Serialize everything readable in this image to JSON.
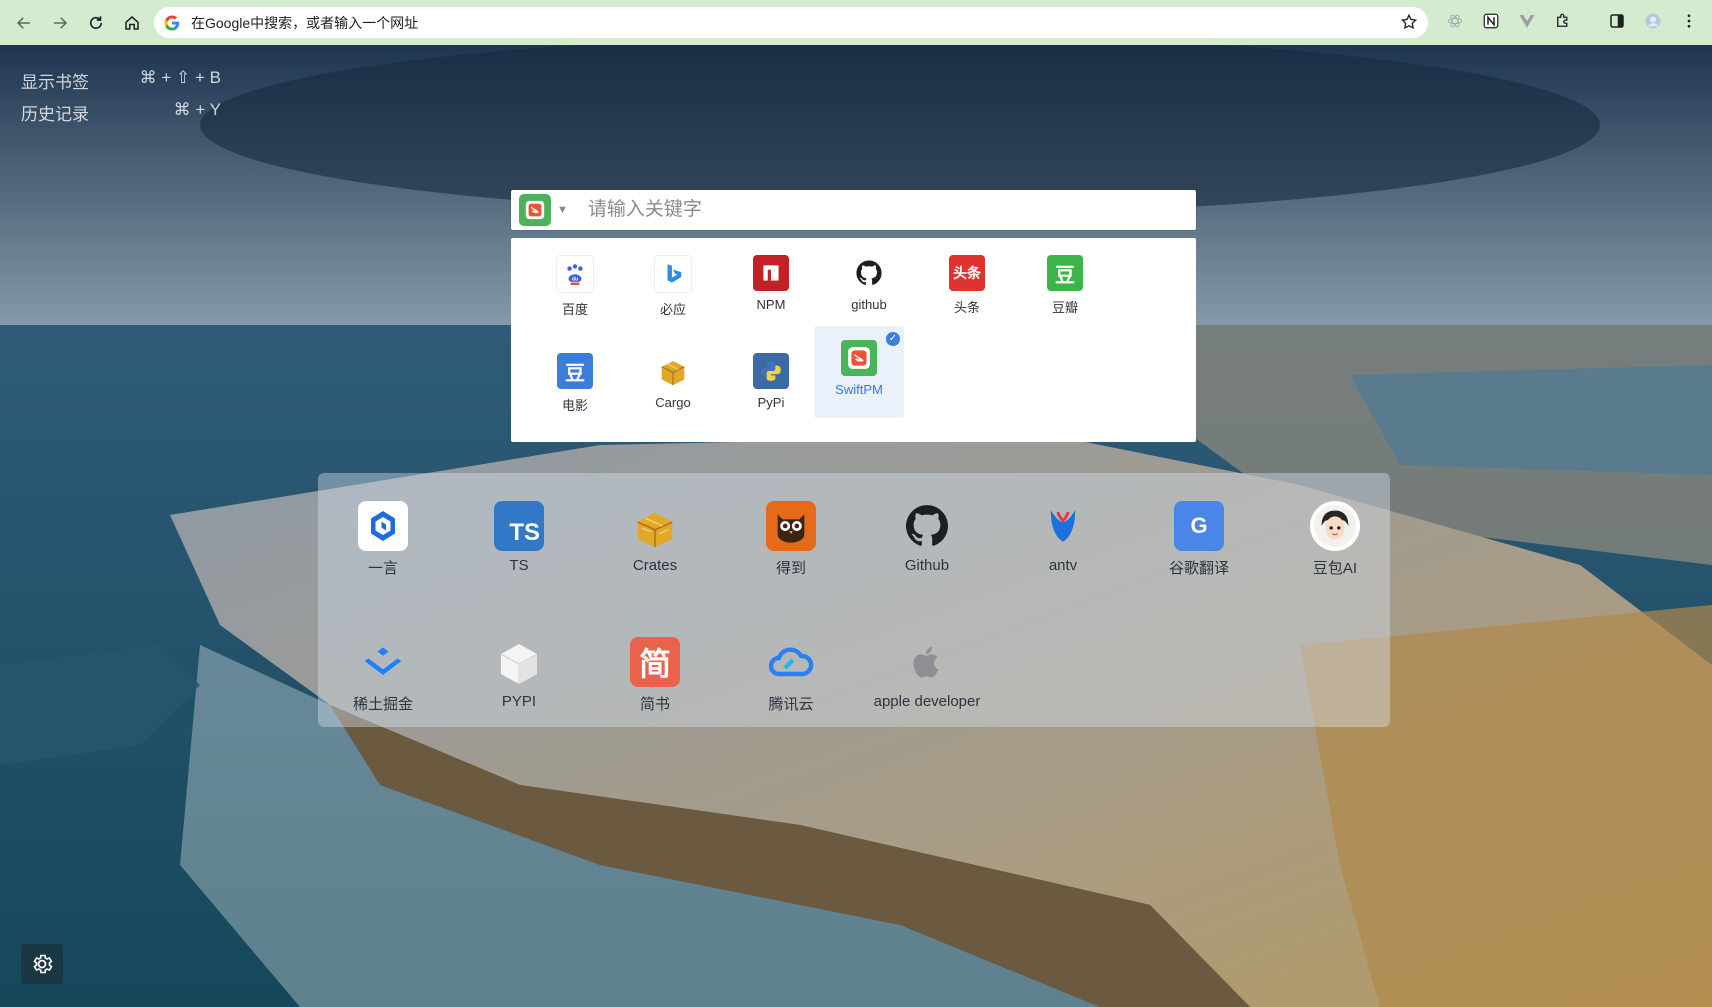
{
  "browser": {
    "omnibox_placeholder": "在Google中搜索，或者输入一个网址"
  },
  "shortcuts": [
    {
      "label": "显示书签",
      "keys": "⌘ + ⇧ + B"
    },
    {
      "label": "历史记录",
      "keys": "⌘ + Y"
    }
  ],
  "search": {
    "placeholder": "请输入关键字",
    "selected_engine": "SwiftPM"
  },
  "engines": [
    {
      "name": "百度",
      "icon": "baidu-icon"
    },
    {
      "name": "必应",
      "icon": "bing-icon"
    },
    {
      "name": "NPM",
      "icon": "npm-icon"
    },
    {
      "name": "github",
      "icon": "github-icon"
    },
    {
      "name": "头条",
      "icon": "toutiao-icon",
      "icon_text": "头条"
    },
    {
      "name": "豆瓣",
      "icon": "douban-icon",
      "icon_text": "豆"
    },
    {
      "name": "电影",
      "icon": "douban-movie-icon",
      "icon_text": "豆"
    },
    {
      "name": "Cargo",
      "icon": "cargo-icon"
    },
    {
      "name": "PyPi",
      "icon": "pypi-icon"
    },
    {
      "name": "SwiftPM",
      "icon": "swiftpm-icon"
    }
  ],
  "tiles": [
    {
      "name": "一言",
      "icon": "hitokoto-icon"
    },
    {
      "name": "TS",
      "icon": "typescript-icon",
      "icon_text": "TS"
    },
    {
      "name": "Crates",
      "icon": "crates-icon"
    },
    {
      "name": "得到",
      "icon": "dedao-owl-icon"
    },
    {
      "name": "Github",
      "icon": "github-icon"
    },
    {
      "name": "antv",
      "icon": "antv-icon"
    },
    {
      "name": "谷歌翻译",
      "icon": "google-translate-icon",
      "icon_text": "G"
    },
    {
      "name": "豆包AI",
      "icon": "doubao-avatar-icon"
    },
    {
      "name": "稀土掘金",
      "icon": "juejin-icon"
    },
    {
      "name": "PYPI",
      "icon": "pypi-cube-icon"
    },
    {
      "name": "简书",
      "icon": "jianshu-icon",
      "icon_text": "简"
    },
    {
      "name": "腾讯云",
      "icon": "tencent-cloud-icon"
    },
    {
      "name": "apple developer",
      "icon": "apple-icon"
    }
  ],
  "colors": {
    "chrome_bar": "#d3ecd0",
    "accent_blue": "#3a7fe0",
    "swift_green": "#4bb35a"
  }
}
